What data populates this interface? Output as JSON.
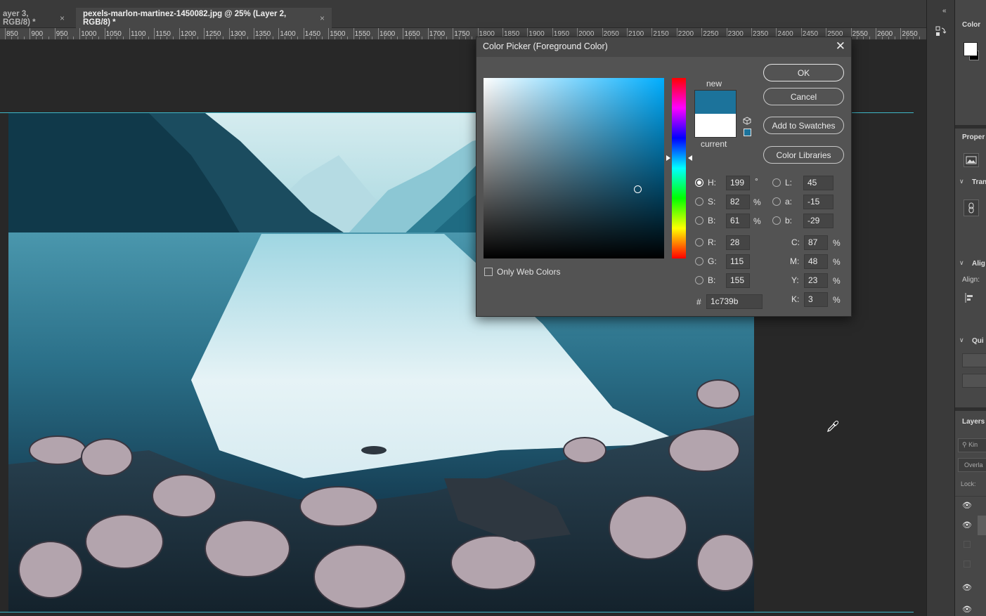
{
  "tabs": [
    {
      "label": "ayer 3, RGB/8) *",
      "close": "×"
    },
    {
      "label": "pexels-marlon-martinez-1450082.jpg @ 25% (Layer 2, RGB/8) *",
      "close": "×"
    }
  ],
  "ruler": {
    "labels": [
      "850",
      "900",
      "950",
      "1000",
      "1050",
      "1100",
      "1150",
      "1200",
      "1250",
      "1300",
      "1350",
      "1400",
      "1450",
      "1500",
      "1550",
      "1600",
      "1650",
      "1700",
      "1750",
      "1800",
      "1850",
      "1900",
      "1950",
      "2000",
      "2050",
      "2100",
      "2150",
      "2200",
      "2250",
      "2300",
      "2350",
      "2400",
      "2450",
      "2500",
      "2550",
      "2600",
      "2650"
    ]
  },
  "dialog": {
    "title": "Color Picker (Foreground Color)",
    "close": "✕",
    "new_label": "new",
    "current_label": "current",
    "new_color": "#1c739b",
    "current_color": "#ffffff",
    "buttons": {
      "ok": "OK",
      "cancel": "Cancel",
      "add_swatches": "Add to Swatches",
      "color_libraries": "Color Libraries"
    },
    "only_web_colors": "Only Web Colors",
    "hsb": {
      "h_label": "H:",
      "h": "199",
      "h_unit": "°",
      "s_label": "S:",
      "s": "82",
      "s_unit": "%",
      "b_label": "B:",
      "b": "61",
      "b_unit": "%"
    },
    "rgb": {
      "r_label": "R:",
      "r": "28",
      "g_label": "G:",
      "g": "115",
      "b_label": "B:",
      "b": "155"
    },
    "lab": {
      "l_label": "L:",
      "l": "45",
      "a_label": "a:",
      "a": "-15",
      "b_label": "b:",
      "b": "-29"
    },
    "cmyk": {
      "c_label": "C:",
      "c": "87",
      "c_unit": "%",
      "m_label": "M:",
      "m": "48",
      "m_unit": "%",
      "y_label": "Y:",
      "y": "23",
      "y_unit": "%",
      "k_label": "K:",
      "k": "3",
      "k_unit": "%"
    },
    "hex_label": "#",
    "hex": "1c739b"
  },
  "right_panel": {
    "collapse": "«",
    "color_title": "Color",
    "properties_title": "Proper",
    "transform_title": "Tran",
    "align_title": "Alig",
    "align_label": "Align:",
    "quick_title": "Qui",
    "layers_title": "Layers",
    "search_kind": "Kin",
    "blend_mode": "Overla",
    "lock_label": "Lock:"
  },
  "icons": {
    "eyedropper": "eyedropper-icon",
    "eye": "eye-icon",
    "cube": "web-safe-cube-icon"
  }
}
